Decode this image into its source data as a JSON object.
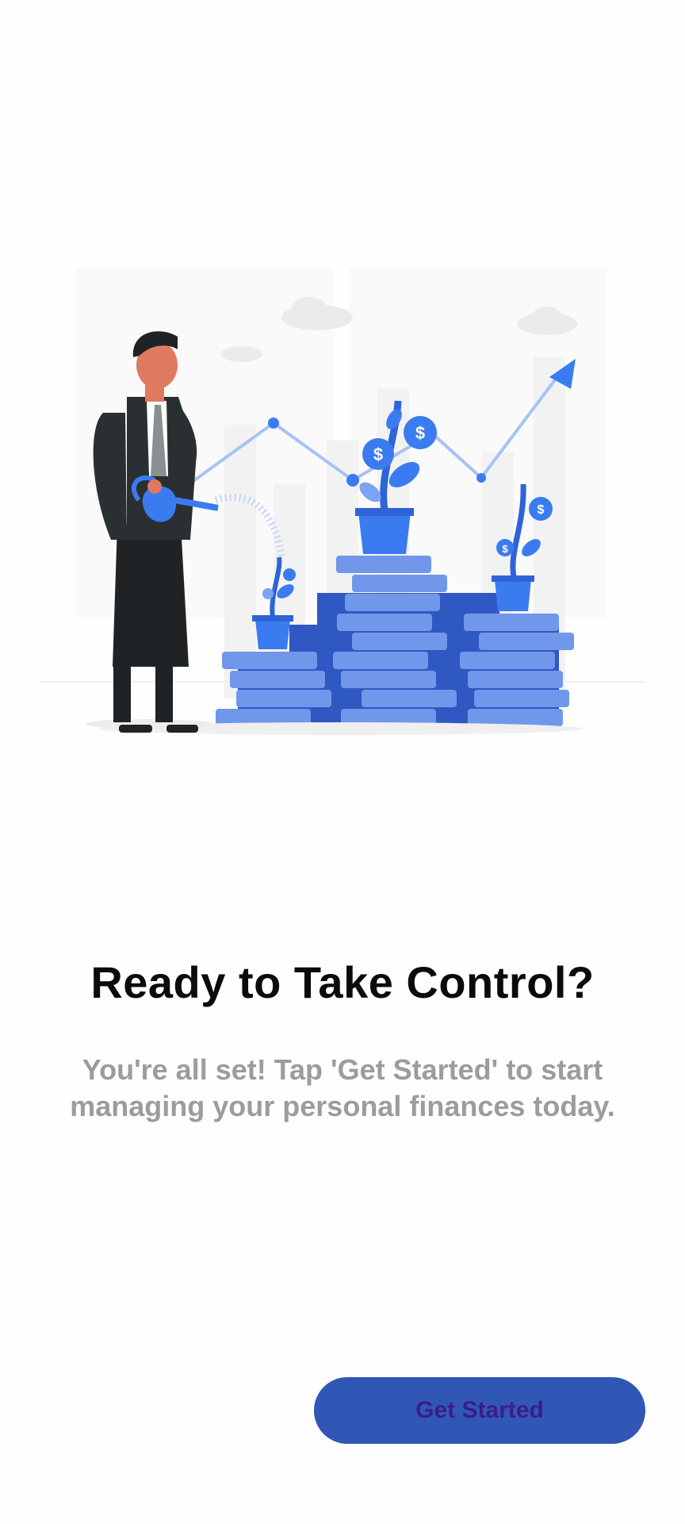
{
  "onboarding": {
    "title": "Ready to Take Control?",
    "subtitle": "You're all set! Tap 'Get Started' to start managing your personal finances today.",
    "cta_label": "Get Started"
  },
  "illustration": {
    "icon": "growth-illustration-icon",
    "accent": "#3a7cf0",
    "coin_light": "#6f95e8",
    "coin_dark": "#2f58c2",
    "suit": "#1f2325"
  },
  "colors": {
    "background": "#fefefe",
    "title": "#0b0b0b",
    "subtitle": "#9c9c9c",
    "button_bg": "#3157b6",
    "button_text": "#3a1e86"
  }
}
